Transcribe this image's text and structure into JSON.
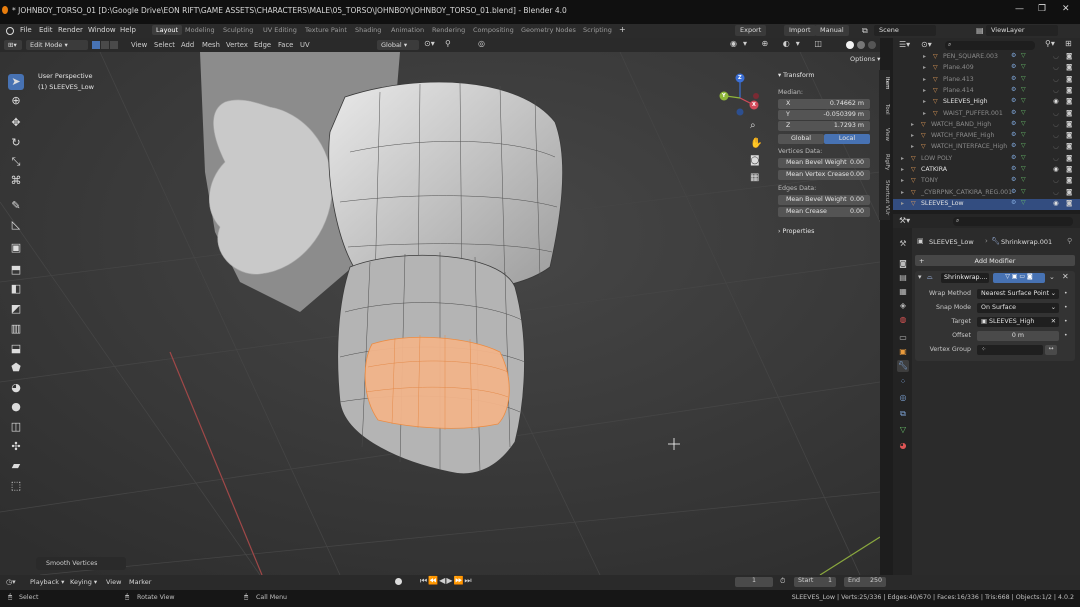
{
  "window": {
    "title": "* JOHNBOY_TORSO_01 [D:\\Google Drive\\EON RIFT\\GAME ASSETS\\CHARACTERS\\MALE\\05_TORSO\\JOHNBOY\\JOHNBOY_TORSO_01.blend] - Blender 4.0",
    "minimize": "—",
    "maximize": "❐",
    "close": "✕"
  },
  "menu": [
    "File",
    "Edit",
    "Render",
    "Window",
    "Help"
  ],
  "workspaces": [
    "Layout",
    "Modeling",
    "Sculpting",
    "UV Editing",
    "Texture Paint",
    "Shading",
    "Animation",
    "Rendering",
    "Compositing",
    "Geometry Nodes",
    "Scripting"
  ],
  "workspace_add": "+",
  "topright": {
    "export": "Export",
    "import": "Import",
    "manual": "Manual",
    "scene": "Scene",
    "view_layer": "ViewLayer"
  },
  "viewport_header": {
    "mode": "Edit Mode",
    "menus": [
      "View",
      "Select",
      "Add",
      "Mesh",
      "Vertex",
      "Edge",
      "Face",
      "UV"
    ],
    "orientation": "Global",
    "options": "Options"
  },
  "viewport": {
    "perspective": "User Perspective",
    "object": "(1) SLEEVES_Low",
    "last_op": "Smooth Vertices",
    "gizmo": {
      "x": "X",
      "y": "Y",
      "z": "Z"
    }
  },
  "npanel": {
    "transform": "Transform",
    "median": "Median:",
    "x_label": "X",
    "x_value": "0.74662 m",
    "y_label": "Y",
    "y_value": "-0.050399 m",
    "z_label": "Z",
    "z_value": "1.7293 m",
    "global": "Global",
    "local": "Local",
    "vertices_data": "Vertices Data:",
    "mean_bevel_weight": "Mean Bevel Weight",
    "mbw_value": "0.00",
    "mean_vertex_crease": "Mean Vertex Crease",
    "mvc_value": "0.00",
    "edges_data": "Edges Data:",
    "mean_bevel_weight_e": "Mean Bevel Weight",
    "mbwe_value": "0.00",
    "mean_crease": "Mean Crease",
    "mc_value": "0.00",
    "properties": "Properties",
    "tabs": [
      "Item",
      "Tool",
      "View",
      "RigiFy",
      "Shortcut VUr"
    ]
  },
  "outliner": {
    "rows": [
      {
        "name": "PEN_SQUARE.003",
        "dim": true
      },
      {
        "name": "Plane.409",
        "dim": true
      },
      {
        "name": "Plane.413",
        "dim": true
      },
      {
        "name": "Plane.414",
        "dim": true
      },
      {
        "name": "SLEEVES_High",
        "dim": false
      },
      {
        "name": "WAIST_PUFFER.001",
        "dim": true
      },
      {
        "name": "WATCH_BAND_High",
        "dim": true
      },
      {
        "name": "WATCH_FRAME_High",
        "dim": true
      },
      {
        "name": "WATCH_INTERFACE_High",
        "dim": true
      },
      {
        "name": "LOW POLY",
        "dim": true
      },
      {
        "name": "CATKIRA",
        "dim": false
      },
      {
        "name": "TONY",
        "dim": true
      },
      {
        "name": "_CYBRPNK_CATKIRA_REG.001",
        "dim": true
      },
      {
        "name": "SLEEVES_Low",
        "dim": false
      }
    ]
  },
  "properties": {
    "object": "SLEEVES_Low",
    "modifier_crumb": "Shrinkwrap.001",
    "add_modifier": "Add Modifier",
    "modifier_name": "Shrinkwrap....",
    "wrap_method_label": "Wrap Method",
    "wrap_method": "Nearest Surface Point",
    "snap_mode_label": "Snap Mode",
    "snap_mode": "On Surface",
    "target_label": "Target",
    "target": "SLEEVES_High",
    "offset_label": "Offset",
    "offset": "0 m",
    "vertex_group_label": "Vertex Group"
  },
  "timeline": {
    "playback": "Playback",
    "keying": "Keying",
    "view": "View",
    "marker": "Marker",
    "current_frame": "1",
    "start_label": "Start",
    "start": "1",
    "end_label": "End",
    "end": "250"
  },
  "status": {
    "select": "Select",
    "rotate_view": "Rotate View",
    "call_menu": "Call Menu",
    "stats": "SLEEVES_Low | Verts:25/336 | Edges:40/670 | Faces:16/336 | Tris:668 | Objects:1/2 | 4.0.2"
  },
  "colors": {
    "accent": "#4772b3",
    "selection": "#f0a060",
    "viewport_bg": "#3c3c3c"
  }
}
